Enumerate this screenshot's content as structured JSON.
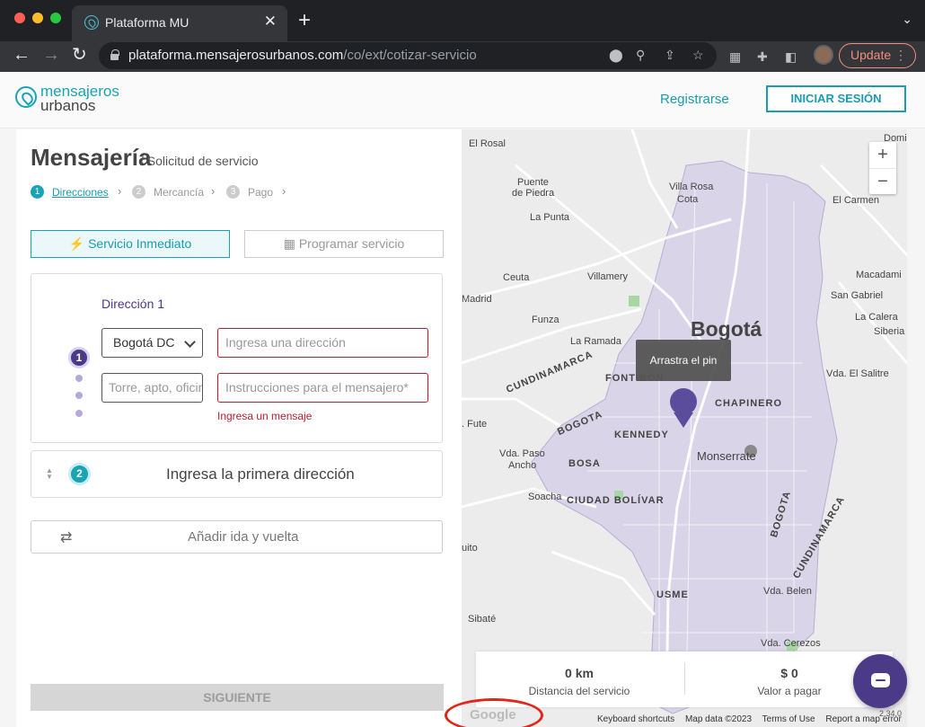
{
  "browser": {
    "tab_title": "Plataforma MU",
    "url_host": "plataforma.mensajerosurbanos.com",
    "url_path": "/co/ext/cotizar-servicio",
    "update_label": "Update"
  },
  "header": {
    "logo_line1": "mensajeros",
    "logo_line2": "urbanos",
    "register": "Registrarse",
    "login": "INICIAR SESIÓN"
  },
  "panel": {
    "title": "Mensajería",
    "subtitle": "/ Solicitud de servicio",
    "steps": [
      {
        "num": "1",
        "label": "Direcciones",
        "active": true
      },
      {
        "num": "2",
        "label": "Mercancía",
        "active": false
      },
      {
        "num": "3",
        "label": "Pago",
        "active": false
      }
    ],
    "service_immediate": "Servicio Inmediato",
    "service_schedule": "Programar servicio",
    "address1": {
      "title": "Dirección 1",
      "badge": "1",
      "city": "Bogotá DC",
      "address_placeholder": "Ingresa una dirección",
      "tower_placeholder": "Torre, apto, oficina",
      "instructions_placeholder": "Instrucciones para el mensajero*",
      "error": "Ingresa un mensaje"
    },
    "address2": {
      "badge": "2",
      "label": "Ingresa la primera dirección"
    },
    "roundtrip": "Añadir ida y vuelta",
    "next": "SIGUIENTE"
  },
  "map": {
    "city_label": "Bogotá",
    "tooltip": "Arrastra el pin",
    "zoom_in": "+",
    "zoom_out": "−",
    "place_labels": {
      "el_rosal": "El Rosal",
      "domi": "Domi",
      "puente_de_piedra_1": "Puente",
      "puente_de_piedra_2": "de Piedra",
      "villa_rosa_1": "Villa Rosa",
      "villa_rosa_2": "Cota",
      "el_carmen": "El Carmen",
      "la_punta": "La Punta",
      "ceuta": "Ceuta",
      "villamery": "Villamery",
      "macadamia": "Macadami",
      "madrid": "Madrid",
      "san_gabriel": "San Gabriel",
      "funza": "Funza",
      "la_calera": "La Calera",
      "siberia": "Siberia",
      "la_ramada": "La Ramada",
      "vda_el_salitre": "Vda. El Salitre",
      "fute": ". Fute",
      "vda_paso_ancho_1": "Vda. Paso",
      "vda_paso_ancho_2": "Ancho",
      "soacha": "Soacha",
      "monserrate": "Monserrate",
      "quito": "uito",
      "vda_belen": "Vda. Belen",
      "sibate": "Sibaté",
      "vda_cerezos": "Vda. Cerezos"
    },
    "district_labels": {
      "fontibon": "FONTIBÓN",
      "chapinero": "CHAPINERO",
      "kennedy": "KENNEDY",
      "bosa": "BOSA",
      "ciudad_bolivar": "CIUDAD BOLÍVAR",
      "usme": "USME",
      "cundinamarca_w": "CUNDINAMARCA",
      "bogota_w": "BOGOTA",
      "bogota_e": "BOGOTA",
      "cundinamarca_e": "CUNDINAMARCA"
    }
  },
  "summary": {
    "distance_value": "0 km",
    "distance_label": "Distancia del servicio",
    "price_value": "$ 0",
    "price_label": "Valor a pagar"
  },
  "map_footer": {
    "google": "Google",
    "shortcuts": "Keyboard shortcuts",
    "map_data": "Map data ©2023",
    "terms": "Terms of Use",
    "report": "Report a map error",
    "version": "2.34.0"
  },
  "colors": {
    "accent": "#1aa3b5",
    "brand_purple": "#4b3a87",
    "error": "#b81d2f"
  }
}
